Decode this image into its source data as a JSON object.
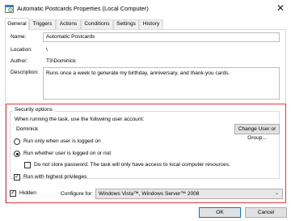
{
  "window": {
    "title": "Automatic Postcards Properties (Local Computer)",
    "close_glyph": "✕",
    "icon": "task-scheduler-icon"
  },
  "tabs": [
    {
      "label": "General",
      "active": true
    },
    {
      "label": "Triggers",
      "active": false
    },
    {
      "label": "Actions",
      "active": false
    },
    {
      "label": "Conditions",
      "active": false
    },
    {
      "label": "Settings",
      "active": false
    },
    {
      "label": "History",
      "active": false
    }
  ],
  "general": {
    "name_label": "Name:",
    "name_value": "Automatic Postcards",
    "location_label": "Location:",
    "location_value": "\\",
    "author_label": "Author:",
    "author_value": "T3\\Dominick",
    "description_label": "Description:",
    "description_value": "Runs once a week to generate my birthday, anniversary, and thank-you cards."
  },
  "security": {
    "group_title": "Security options",
    "account_prompt": "When running the task, use the following user account:",
    "account_value": "Dominick",
    "change_user_button": "Change User or Group...",
    "radio_logged_on": "Run only when user is logged on",
    "radio_logged_on_or_not": "Run whether user is logged on or not",
    "selected_radio": "logged_on_or_not",
    "no_store_password": "Do not store password.  The task will only have access to local computer resources.",
    "no_store_password_checked": false,
    "highest_privileges": "Run with highest privileges",
    "highest_privileges_checked": true,
    "hidden_label": "Hidden",
    "hidden_checked": true,
    "configure_label": "Configure for:",
    "configure_value": "Windows Vista™, Windows Server™ 2008",
    "check_glyph": "✓",
    "chevron_glyph": "⌄",
    "highlight_color": "#e8343a"
  },
  "footer": {
    "ok_button": "OK",
    "cancel_button": "Cancel"
  }
}
